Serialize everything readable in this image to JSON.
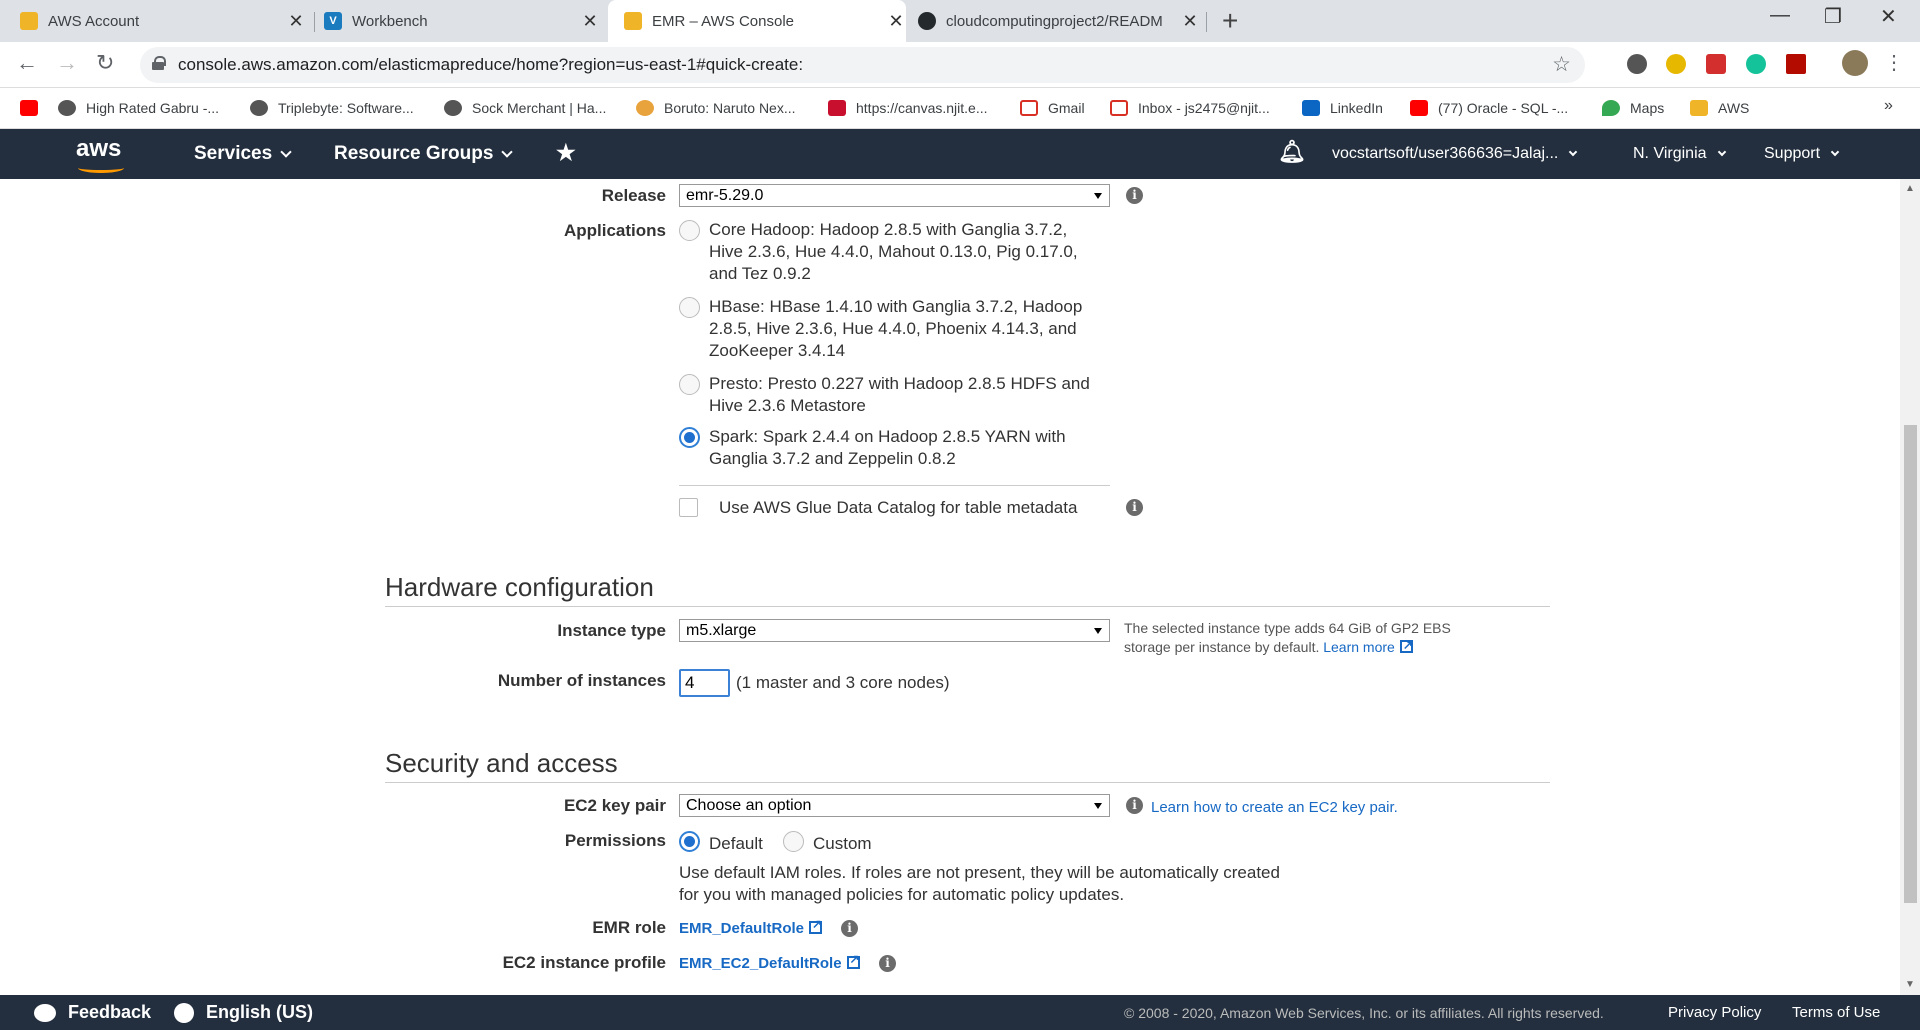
{
  "browser": {
    "tabs": [
      {
        "title": "AWS Account",
        "icon": "aws-box-icon"
      },
      {
        "title": "Workbench",
        "icon": "vocareum-icon"
      },
      {
        "title": "EMR – AWS Console",
        "icon": "aws-box-icon"
      },
      {
        "title": "cloudcomputingproject2/READM",
        "icon": "github-icon"
      }
    ],
    "url": "console.aws.amazon.com/elasticmapreduce/home?region=us-east-1#quick-create:",
    "bookmarks": [
      {
        "label": "High Rated Gabru -...",
        "color": "#555555"
      },
      {
        "label": "Triplebyte: Software...",
        "color": "#555555"
      },
      {
        "label": "Sock Merchant | Ha...",
        "color": "#555555"
      },
      {
        "label": "Boruto: Naruto Nex...",
        "color": "#e8a33d"
      },
      {
        "label": "https://canvas.njit.e...",
        "color": "#c8102e"
      },
      {
        "label": "Gmail",
        "color": "#d93025"
      },
      {
        "label": "Inbox - js2475@njit...",
        "color": "#d93025"
      },
      {
        "label": "LinkedIn",
        "color": "#0a66c2"
      },
      {
        "label": "(77) Oracle - SQL -...",
        "color": "#ff0000"
      },
      {
        "label": "Maps",
        "color": "#34a853"
      },
      {
        "label": "AWS",
        "color": "#f0b429"
      }
    ],
    "more": "»"
  },
  "aws_nav": {
    "logo": "aws",
    "services": "Services",
    "resource_groups": "Resource Groups",
    "account": "vocstartsoft/user366636=Jalaj...",
    "region": "N. Virginia",
    "support": "Support"
  },
  "form": {
    "release_label": "Release",
    "release_value": "emr-5.29.0",
    "applications_label": "Applications",
    "applications": [
      {
        "lines": [
          "Core Hadoop: Hadoop 2.8.5 with Ganglia 3.7.2,",
          "Hive 2.3.6, Hue 4.4.0, Mahout 0.13.0, Pig 0.17.0,",
          "and Tez 0.9.2"
        ],
        "selected": false
      },
      {
        "lines": [
          "HBase: HBase 1.4.10 with Ganglia 3.7.2, Hadoop",
          "2.8.5, Hive 2.3.6, Hue 4.4.0, Phoenix 4.14.3, and",
          "ZooKeeper 3.4.14"
        ],
        "selected": false
      },
      {
        "lines": [
          "Presto: Presto 0.227 with Hadoop 2.8.5 HDFS and",
          "Hive 2.3.6 Metastore"
        ],
        "selected": false
      },
      {
        "lines": [
          "Spark: Spark 2.4.4 on Hadoop 2.8.5 YARN with",
          "Ganglia 3.7.2 and Zeppelin 0.8.2"
        ],
        "selected": true
      }
    ],
    "glue_label": "Use AWS Glue Data Catalog for table metadata",
    "hardware_title": "Hardware configuration",
    "instance_type_label": "Instance type",
    "instance_type_value": "m5.xlarge",
    "instance_hint_line1": "The selected instance type adds 64 GiB of GP2 EBS",
    "instance_hint_line2": "storage per instance by default.",
    "learn_more": "Learn more",
    "num_instances_label": "Number of instances",
    "num_instances_value": "4",
    "num_instances_note": "(1 master and 3 core nodes)",
    "security_title": "Security and access",
    "keypair_label": "EC2 key pair",
    "keypair_value": "Choose an option",
    "keypair_link": "Learn how to create an EC2 key pair.",
    "permissions_label": "Permissions",
    "perm_default": "Default",
    "perm_custom": "Custom",
    "perm_desc_line1": "Use default IAM roles. If roles are not present, they will be automatically created",
    "perm_desc_line2": "for you with managed policies for automatic policy updates.",
    "emr_role_label": "EMR role",
    "emr_role_value": "EMR_DefaultRole",
    "ec2_profile_label": "EC2 instance profile",
    "ec2_profile_value": "EMR_EC2_DefaultRole"
  },
  "footer": {
    "feedback": "Feedback",
    "language": "English (US)",
    "copyright": "© 2008 - 2020, Amazon Web Services, Inc. or its affiliates. All rights reserved.",
    "privacy": "Privacy Policy",
    "terms": "Terms of Use"
  }
}
